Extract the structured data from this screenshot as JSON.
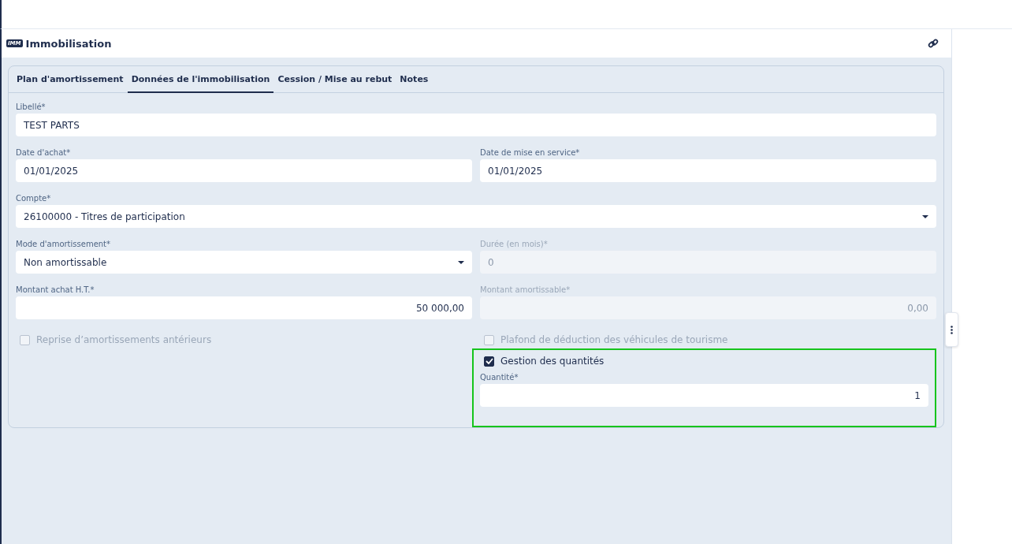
{
  "header": {
    "badge": "IMM",
    "title": "Immobilisation"
  },
  "tabs": [
    {
      "label": "Plan d'amortissement",
      "selected": false
    },
    {
      "label": "Données de l'immobilisation",
      "selected": true
    },
    {
      "label": "Cession / Mise au rebut",
      "selected": false
    },
    {
      "label": "Notes",
      "selected": false
    }
  ],
  "rows": [
    {
      "fields": [
        {
          "kind": "text",
          "label": "Libellé*",
          "value": "TEST PARTS",
          "disabled": false
        }
      ]
    },
    {
      "fields": [
        {
          "kind": "text",
          "label": "Date d'achat*",
          "value": "01/01/2025",
          "disabled": false
        },
        {
          "kind": "text",
          "label": "Date de mise en service*",
          "value": "01/01/2025",
          "disabled": false
        }
      ]
    },
    {
      "fields": [
        {
          "kind": "select",
          "label": "Compte*",
          "value": "26100000 - Titres de participation",
          "disabled": false
        }
      ]
    },
    {
      "fields": [
        {
          "kind": "select",
          "label": "Mode d'amortissement*",
          "value": "Non amortissable",
          "disabled": false
        },
        {
          "kind": "text",
          "label": "Durée (en mois)*",
          "value": "0",
          "disabled": true
        }
      ]
    },
    {
      "fields": [
        {
          "kind": "number",
          "label": "Montant achat H.T.*",
          "value": "50 000,00",
          "disabled": false
        },
        {
          "kind": "number",
          "label": "Montant amortissable*",
          "value": "0,00",
          "disabled": true
        }
      ]
    }
  ],
  "checkboxes": [
    {
      "label": "Reprise d’amortissements antérieurs",
      "checked": false,
      "disabled": true
    },
    {
      "label": "Plafond de déduction des véhicules de tourisme",
      "checked": false,
      "disabled": true
    }
  ],
  "quantity_section": {
    "checkbox": {
      "label": "Gestion des quantités",
      "checked": true,
      "disabled": false
    },
    "field": {
      "kind": "number",
      "label": "Quantité*",
      "value": "1",
      "disabled": false
    }
  }
}
